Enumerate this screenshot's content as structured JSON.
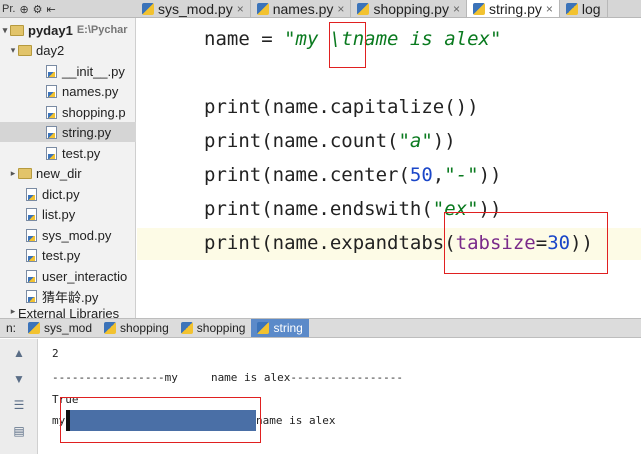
{
  "topbar": {
    "project_label": "Pr.",
    "tabs": [
      {
        "label": "sys_mod.py",
        "active": false
      },
      {
        "label": "names.py",
        "active": false
      },
      {
        "label": "shopping.py",
        "active": false
      },
      {
        "label": "string.py",
        "active": true
      },
      {
        "label": "log",
        "active": false
      }
    ]
  },
  "project": {
    "root": "pyday1",
    "root_path": "E:\\Pychar",
    "items": [
      {
        "label": "day2",
        "type": "folder",
        "level": 1,
        "expanded": true
      },
      {
        "label": "__init__.py",
        "type": "file",
        "level": 2
      },
      {
        "label": "names.py",
        "type": "file",
        "level": 2
      },
      {
        "label": "shopping.p",
        "type": "file",
        "level": 2
      },
      {
        "label": "string.py",
        "type": "file",
        "level": 2,
        "selected": true
      },
      {
        "label": "test.py",
        "type": "file",
        "level": 2
      },
      {
        "label": "new_dir",
        "type": "folder",
        "level": 1,
        "expanded": false
      },
      {
        "label": "dict.py",
        "type": "file",
        "level": 1
      },
      {
        "label": "list.py",
        "type": "file",
        "level": 1
      },
      {
        "label": "sys_mod.py",
        "type": "file",
        "level": 1
      },
      {
        "label": "test.py",
        "type": "file",
        "level": 1
      },
      {
        "label": "user_interactio",
        "type": "file",
        "level": 1
      },
      {
        "label": "猜年龄.py",
        "type": "file",
        "level": 1
      },
      {
        "label": "External Libraries",
        "type": "lib",
        "level": 0
      }
    ]
  },
  "code": {
    "line1_var": "name = ",
    "line1_str": "\"my \\tname is alex\"",
    "line2": "print(name.capitalize())",
    "line3_a": "print(name.count(",
    "line3_s": "\"a\"",
    "line3_b": "))",
    "line4_a": "print(name.center(",
    "line4_n": "50",
    "line4_c": ",",
    "line4_s": "\"-\"",
    "line4_b": "))",
    "line5_a": "print(name.endswith(",
    "line5_s": "\"ex\"",
    "line5_b": "))",
    "line6_a": "print(name.expandtabs(",
    "line6_k": "tabsize",
    "line6_eq": "=",
    "line6_n": "30",
    "line6_b": "))"
  },
  "runbar": {
    "prefix": "n:",
    "tabs": [
      "sys_mod",
      "shopping",
      "shopping",
      "string"
    ]
  },
  "console": {
    "lines": [
      "2",
      "-----------------my     name is alex-----------------",
      "True",
      "my",
      "name is alex"
    ]
  }
}
